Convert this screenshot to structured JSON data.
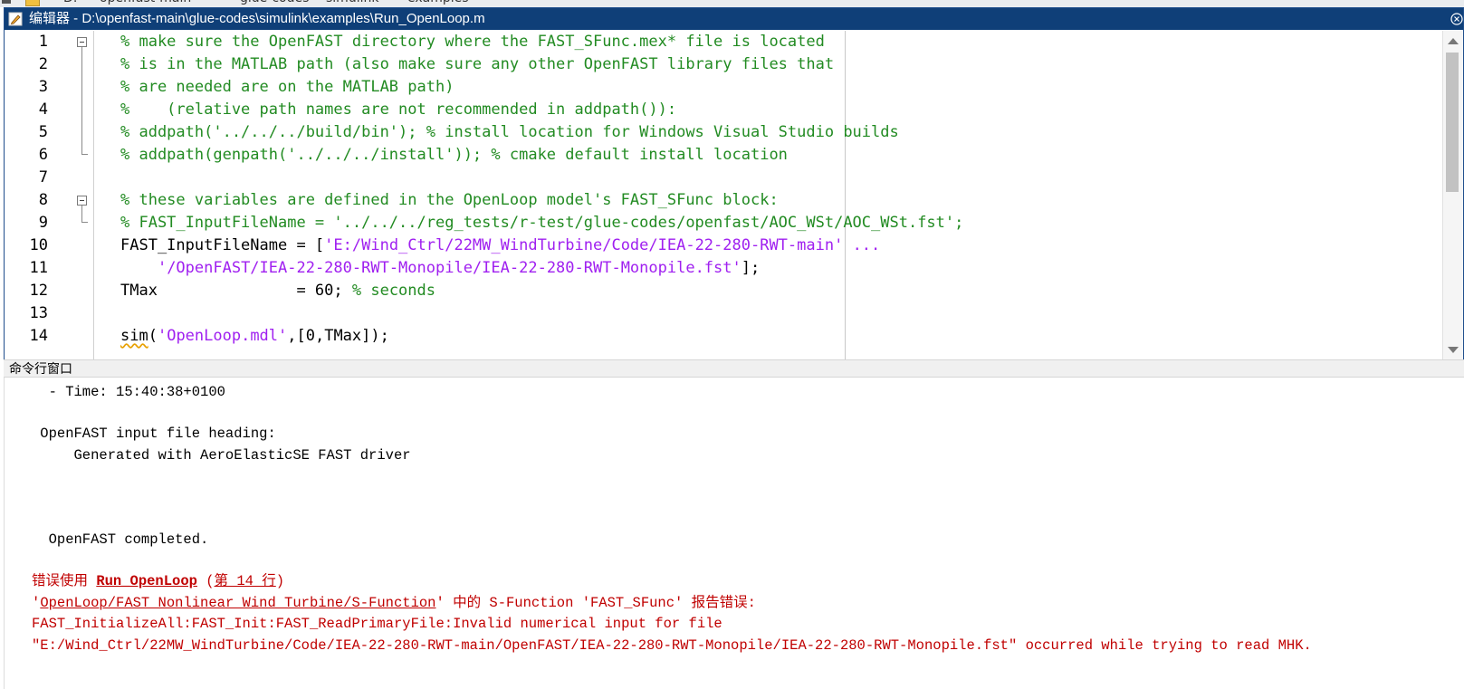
{
  "top_trim": {
    "text_a": "D:",
    "text_b": "openfast-main",
    "text_c": "glue-codes",
    "text_d": "simulink",
    "text_e": "examples"
  },
  "editor": {
    "title": "编辑器 - D:\\openfast-main\\glue-codes\\simulink\\examples\\Run_OpenLoop.m",
    "line_numbers": [
      "1",
      "2",
      "3",
      "4",
      "5",
      "6",
      "7",
      "8",
      "9",
      "10",
      "11",
      "12",
      "13",
      "14"
    ],
    "lines": {
      "l1": "% make sure the OpenFAST directory where the FAST_SFunc.mex* file is located",
      "l2": "% is in the MATLAB path (also make sure any other OpenFAST library files that",
      "l3": "% are needed are on the MATLAB path)",
      "l4": "%    (relative path names are not recommended in addpath()):",
      "l5": "% addpath('../../../build/bin'); % install location for Windows Visual Studio builds",
      "l6": "% addpath(genpath('../../../install')); % cmake default install location",
      "l8": "% these variables are defined in the OpenLoop model's FAST_SFunc block:",
      "l9": "% FAST_InputFileName = '../../../reg_tests/r-test/glue-codes/openfast/AOC_WSt/AOC_WSt.fst';",
      "l10_a": "FAST_InputFileName = [",
      "l10_b": "'E:/Wind_Ctrl/22MW_WindTurbine/Code/IEA-22-280-RWT-main'",
      "l10_c": " ...",
      "l11_a": "    ",
      "l11_b": "'/OpenFAST/IEA-22-280-RWT-Monopile/IEA-22-280-RWT-Monopile.fst'",
      "l11_c": "];",
      "l12_a": "TMax               = 60; ",
      "l12_b": "% seconds",
      "l14_a": "sim",
      "l14_b": "(",
      "l14_c": "'OpenLoop.mdl'",
      "l14_d": ",[0,TMax]);"
    }
  },
  "command_window": {
    "header": "命令行窗口",
    "out_time": "  - Time: 15:40:38+0100",
    "out_heading": " OpenFAST input file heading:",
    "out_generated": "     Generated with AeroElasticSE FAST driver",
    "out_completed": "  OpenFAST completed.",
    "err1_a": "错误使用 ",
    "err1_link": "Run_OpenLoop",
    "err1_b": " (",
    "err1_line_link": "第 14 行",
    "err1_c": ")",
    "err2_a": "'",
    "err2_link": "OpenLoop/FAST Nonlinear Wind Turbine/S-Function",
    "err2_b": "' 中的 S-Function 'FAST_SFunc' 报告错误:",
    "err3": "FAST_InitializeAll:FAST_Init:FAST_ReadPrimaryFile:Invalid numerical input for file",
    "err4": "\"E:/Wind_Ctrl/22MW_WindTurbine/Code/IEA-22-280-RWT-main/OpenFAST/IEA-22-280-RWT-Monopile/IEA-22-280-RWT-Monopile.fst\" occurred while trying to read MHK."
  },
  "colors": {
    "title_bar": "#0f3f78",
    "comment": "#228b22",
    "string": "#a020f0",
    "error": "#c00000"
  },
  "icons": {
    "title": "editor-pencil-icon",
    "close": "close-icon",
    "fold": "fold-minus-icon"
  }
}
